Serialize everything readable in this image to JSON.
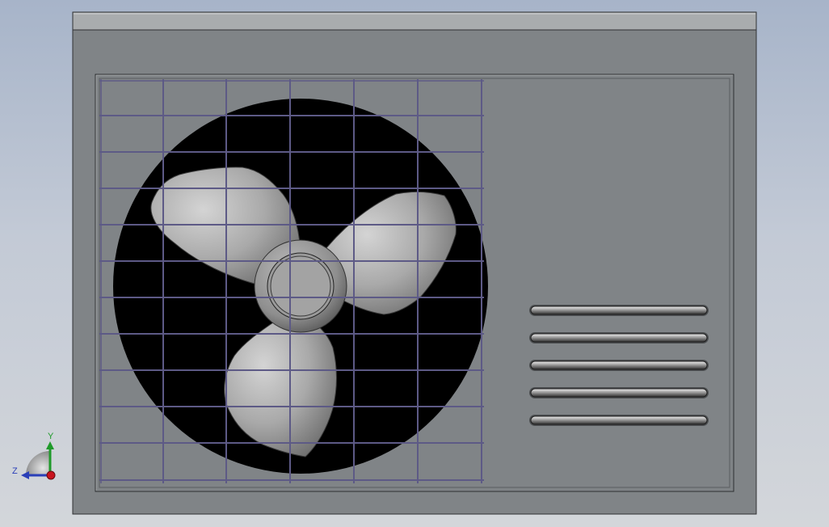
{
  "viewport": {
    "background_top": "#a7b4c9",
    "background_bottom": "#d3d6da"
  },
  "model": {
    "name": "outdoor-ac-unit",
    "housing_color": "#808487",
    "fan_blade_count": 3,
    "vent_slot_count": 5
  },
  "triad": {
    "y_label": "Y",
    "z_label": "Z",
    "y_color": "#1f9a2a",
    "z_color": "#2a3fb8",
    "x_color": "#c8141e"
  }
}
